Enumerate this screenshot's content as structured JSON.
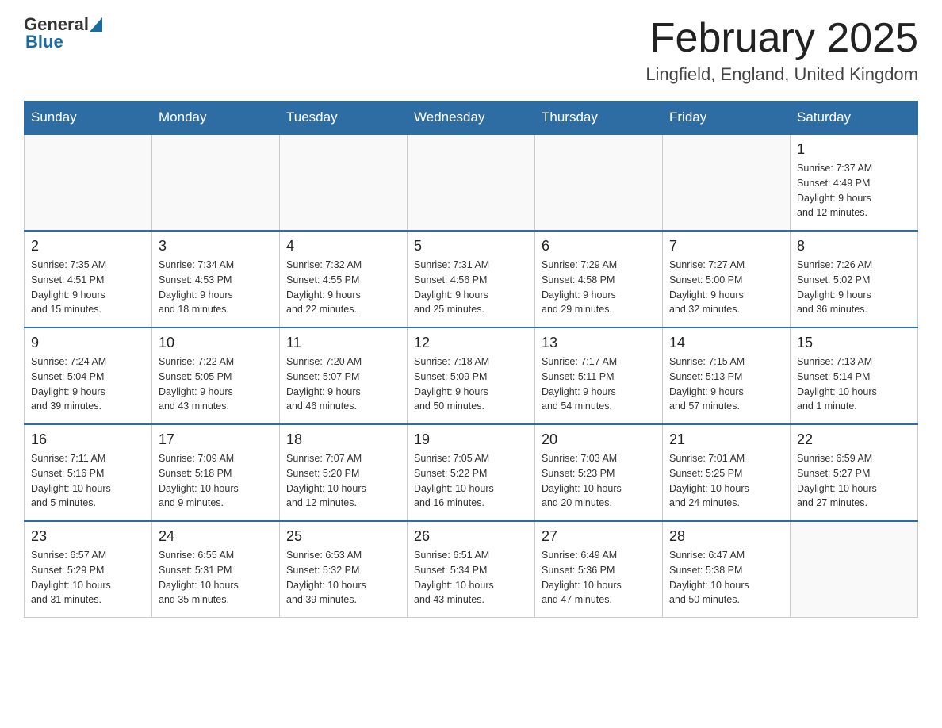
{
  "header": {
    "logo_general": "General",
    "logo_blue": "Blue",
    "month_title": "February 2025",
    "location": "Lingfield, England, United Kingdom"
  },
  "weekdays": [
    "Sunday",
    "Monday",
    "Tuesday",
    "Wednesday",
    "Thursday",
    "Friday",
    "Saturday"
  ],
  "weeks": [
    [
      {
        "day": "",
        "info": ""
      },
      {
        "day": "",
        "info": ""
      },
      {
        "day": "",
        "info": ""
      },
      {
        "day": "",
        "info": ""
      },
      {
        "day": "",
        "info": ""
      },
      {
        "day": "",
        "info": ""
      },
      {
        "day": "1",
        "info": "Sunrise: 7:37 AM\nSunset: 4:49 PM\nDaylight: 9 hours\nand 12 minutes."
      }
    ],
    [
      {
        "day": "2",
        "info": "Sunrise: 7:35 AM\nSunset: 4:51 PM\nDaylight: 9 hours\nand 15 minutes."
      },
      {
        "day": "3",
        "info": "Sunrise: 7:34 AM\nSunset: 4:53 PM\nDaylight: 9 hours\nand 18 minutes."
      },
      {
        "day": "4",
        "info": "Sunrise: 7:32 AM\nSunset: 4:55 PM\nDaylight: 9 hours\nand 22 minutes."
      },
      {
        "day": "5",
        "info": "Sunrise: 7:31 AM\nSunset: 4:56 PM\nDaylight: 9 hours\nand 25 minutes."
      },
      {
        "day": "6",
        "info": "Sunrise: 7:29 AM\nSunset: 4:58 PM\nDaylight: 9 hours\nand 29 minutes."
      },
      {
        "day": "7",
        "info": "Sunrise: 7:27 AM\nSunset: 5:00 PM\nDaylight: 9 hours\nand 32 minutes."
      },
      {
        "day": "8",
        "info": "Sunrise: 7:26 AM\nSunset: 5:02 PM\nDaylight: 9 hours\nand 36 minutes."
      }
    ],
    [
      {
        "day": "9",
        "info": "Sunrise: 7:24 AM\nSunset: 5:04 PM\nDaylight: 9 hours\nand 39 minutes."
      },
      {
        "day": "10",
        "info": "Sunrise: 7:22 AM\nSunset: 5:05 PM\nDaylight: 9 hours\nand 43 minutes."
      },
      {
        "day": "11",
        "info": "Sunrise: 7:20 AM\nSunset: 5:07 PM\nDaylight: 9 hours\nand 46 minutes."
      },
      {
        "day": "12",
        "info": "Sunrise: 7:18 AM\nSunset: 5:09 PM\nDaylight: 9 hours\nand 50 minutes."
      },
      {
        "day": "13",
        "info": "Sunrise: 7:17 AM\nSunset: 5:11 PM\nDaylight: 9 hours\nand 54 minutes."
      },
      {
        "day": "14",
        "info": "Sunrise: 7:15 AM\nSunset: 5:13 PM\nDaylight: 9 hours\nand 57 minutes."
      },
      {
        "day": "15",
        "info": "Sunrise: 7:13 AM\nSunset: 5:14 PM\nDaylight: 10 hours\nand 1 minute."
      }
    ],
    [
      {
        "day": "16",
        "info": "Sunrise: 7:11 AM\nSunset: 5:16 PM\nDaylight: 10 hours\nand 5 minutes."
      },
      {
        "day": "17",
        "info": "Sunrise: 7:09 AM\nSunset: 5:18 PM\nDaylight: 10 hours\nand 9 minutes."
      },
      {
        "day": "18",
        "info": "Sunrise: 7:07 AM\nSunset: 5:20 PM\nDaylight: 10 hours\nand 12 minutes."
      },
      {
        "day": "19",
        "info": "Sunrise: 7:05 AM\nSunset: 5:22 PM\nDaylight: 10 hours\nand 16 minutes."
      },
      {
        "day": "20",
        "info": "Sunrise: 7:03 AM\nSunset: 5:23 PM\nDaylight: 10 hours\nand 20 minutes."
      },
      {
        "day": "21",
        "info": "Sunrise: 7:01 AM\nSunset: 5:25 PM\nDaylight: 10 hours\nand 24 minutes."
      },
      {
        "day": "22",
        "info": "Sunrise: 6:59 AM\nSunset: 5:27 PM\nDaylight: 10 hours\nand 27 minutes."
      }
    ],
    [
      {
        "day": "23",
        "info": "Sunrise: 6:57 AM\nSunset: 5:29 PM\nDaylight: 10 hours\nand 31 minutes."
      },
      {
        "day": "24",
        "info": "Sunrise: 6:55 AM\nSunset: 5:31 PM\nDaylight: 10 hours\nand 35 minutes."
      },
      {
        "day": "25",
        "info": "Sunrise: 6:53 AM\nSunset: 5:32 PM\nDaylight: 10 hours\nand 39 minutes."
      },
      {
        "day": "26",
        "info": "Sunrise: 6:51 AM\nSunset: 5:34 PM\nDaylight: 10 hours\nand 43 minutes."
      },
      {
        "day": "27",
        "info": "Sunrise: 6:49 AM\nSunset: 5:36 PM\nDaylight: 10 hours\nand 47 minutes."
      },
      {
        "day": "28",
        "info": "Sunrise: 6:47 AM\nSunset: 5:38 PM\nDaylight: 10 hours\nand 50 minutes."
      },
      {
        "day": "",
        "info": ""
      }
    ]
  ]
}
